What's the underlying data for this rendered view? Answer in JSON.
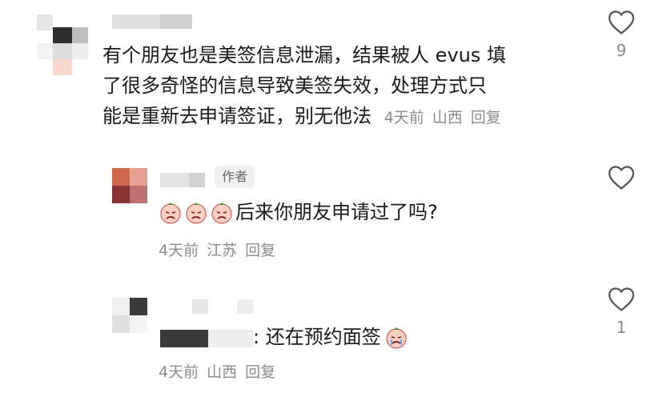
{
  "comments": [
    {
      "text_line1": "有个朋友也是美签信息泄漏，结果被人 evus 填",
      "text_line2": "了很多奇怪的信息导致美签失效，处理方式只",
      "text_line3": "能是重新去申请签证，别无他法",
      "time": "4天前",
      "location": "山西",
      "reply_label": "回复",
      "like_count": "9"
    },
    {
      "author_badge": "作者",
      "emoji_name": "crying-face-emoji",
      "text": "后来你朋友申请过了吗?",
      "time": "4天前",
      "location": "江苏",
      "reply_label": "回复",
      "like_count": ""
    },
    {
      "text": ": 还在预约面签",
      "emoji_name": "crying-face-emoji",
      "time": "4天前",
      "location": "山西",
      "reply_label": "回复",
      "like_count": "1"
    }
  ],
  "icons": {
    "like": "heart-outline-icon"
  },
  "colors": {
    "meta": "#8c8c8c",
    "text": "#1a1a1a",
    "badge_bg": "#f0f0f0"
  }
}
